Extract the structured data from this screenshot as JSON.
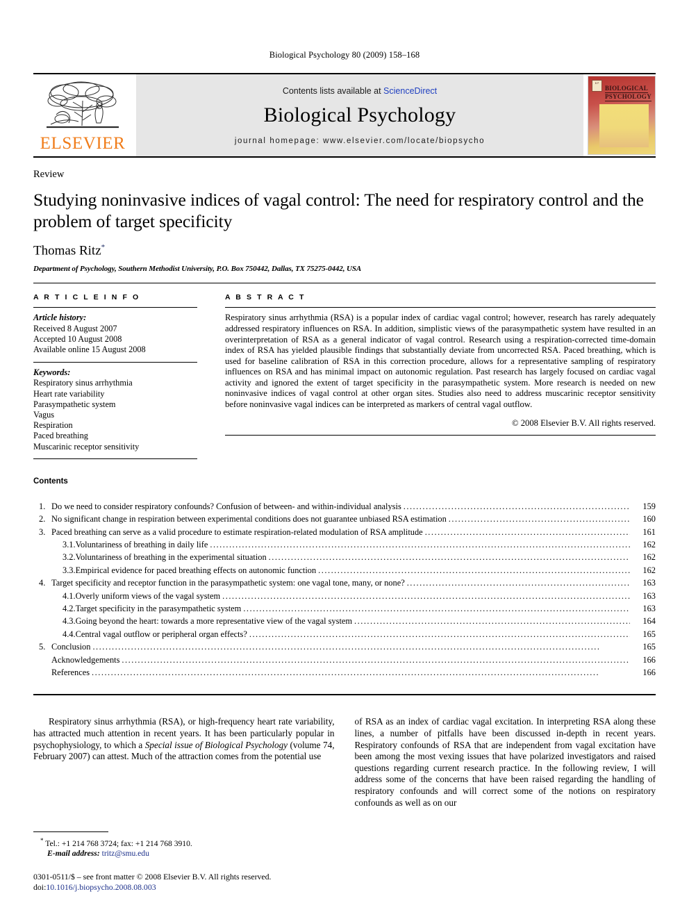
{
  "running_head": "Biological Psychology 80 (2009) 158–168",
  "masthead": {
    "publisher_name": "ELSEVIER",
    "contents_prefix": "Contents lists available at ",
    "contents_link": "ScienceDirect",
    "journal_name": "Biological Psychology",
    "homepage": "journal homepage: www.elsevier.com/locate/biopsycho",
    "cover": {
      "line1": "BIOLOGICAL",
      "line2": "PSYCHOLOGY",
      "mini_logo_text": "B P"
    }
  },
  "article": {
    "doctype": "Review",
    "title": "Studying noninvasive indices of vagal control: The need for respiratory control and the problem of target specificity",
    "author": "Thomas Ritz",
    "author_marker": "*",
    "affiliation": "Department of Psychology, Southern Methodist University, P.O. Box 750442, Dallas, TX 75275-0442, USA"
  },
  "info": {
    "heading": "A R T I C L E   I N F O",
    "history_label": "Article history:",
    "history": [
      "Received 8 August 2007",
      "Accepted 10 August 2008",
      "Available online 15 August 2008"
    ],
    "keywords_label": "Keywords:",
    "keywords": [
      "Respiratory sinus arrhythmia",
      "Heart rate variability",
      "Parasympathetic system",
      "Vagus",
      "Respiration",
      "Paced breathing",
      "Muscarinic receptor sensitivity"
    ]
  },
  "abstract": {
    "heading": "A B S T R A C T",
    "text": "Respiratory sinus arrhythmia (RSA) is a popular index of cardiac vagal control; however, research has rarely adequately addressed respiratory influences on RSA. In addition, simplistic views of the parasympathetic system have resulted in an overinterpretation of RSA as a general indicator of vagal control. Research using a respiration-corrected time-domain index of RSA has yielded plausible findings that substantially deviate from uncorrected RSA. Paced breathing, which is used for baseline calibration of RSA in this correction procedure, allows for a representative sampling of respiratory influences on RSA and has minimal impact on autonomic regulation. Past research has largely focused on cardiac vagal activity and ignored the extent of target specificity in the parasympathetic system. More research is needed on new noninvasive indices of vagal control at other organ sites. Studies also need to address muscarinic receptor sensitivity before noninvasive vagal indices can be interpreted as markers of central vagal outflow.",
    "copyright": "© 2008 Elsevier B.V. All rights reserved."
  },
  "contents": {
    "heading": "Contents",
    "entries": [
      {
        "num": "1.",
        "sub": false,
        "text": "Do we need to consider respiratory confounds? Confusion of between- and within-individual analysis",
        "page": "159"
      },
      {
        "num": "2.",
        "sub": false,
        "text": "No significant change in respiration between experimental conditions does not guarantee unbiased RSA estimation",
        "page": "160"
      },
      {
        "num": "3.",
        "sub": false,
        "text": "Paced breathing can serve as a valid procedure to estimate respiration-related modulation of RSA amplitude",
        "page": "161"
      },
      {
        "num": "3.1.",
        "sub": true,
        "text": "Voluntariness of breathing in daily life",
        "page": "162"
      },
      {
        "num": "3.2.",
        "sub": true,
        "text": "Voluntariness of breathing in the experimental situation",
        "page": "162"
      },
      {
        "num": "3.3.",
        "sub": true,
        "text": "Empirical evidence for paced breathing effects on autonomic function",
        "page": "162"
      },
      {
        "num": "4.",
        "sub": false,
        "text": "Target specificity and receptor function in the parasympathetic system: one vagal tone, many, or none?",
        "page": "163"
      },
      {
        "num": "4.1.",
        "sub": true,
        "text": "Overly uniform views of the vagal system",
        "page": "163"
      },
      {
        "num": "4.2.",
        "sub": true,
        "text": "Target specificity in the parasympathetic system",
        "page": "163"
      },
      {
        "num": "4.3.",
        "sub": true,
        "text": "Going beyond the heart: towards a more representative view of the vagal system",
        "page": "164"
      },
      {
        "num": "4.4.",
        "sub": true,
        "text": "Central vagal outflow or peripheral organ effects?",
        "page": "165"
      },
      {
        "num": "5.",
        "sub": false,
        "text": "Conclusion",
        "page": "165"
      },
      {
        "num": "",
        "sub": false,
        "text": "Acknowledgements",
        "page": "166"
      },
      {
        "num": "",
        "sub": false,
        "text": "References",
        "page": "166"
      }
    ]
  },
  "body": {
    "left_col_part1": "Respiratory sinus arrhythmia (RSA), or high-frequency heart rate variability, has attracted much attention in recent years. It has been particularly popular in psychophysiology, to which a ",
    "left_col_italic": "Special issue of Biological Psychology",
    "left_col_part2": " (volume 74, February 2007) can attest. Much of the attraction comes from the potential use",
    "right_col": "of RSA as an index of cardiac vagal excitation. In interpreting RSA along these lines, a number of pitfalls have been discussed in-depth in recent years. Respiratory confounds of RSA that are independent from vagal excitation have been among the most vexing issues that have polarized investigators and raised questions regarding current research practice. In the following review, I will address some of the concerns that have been raised regarding the handling of respiratory confounds and will correct some of the notions on respiratory confounds as well as on our"
  },
  "footnotes": {
    "marker": "*",
    "contact": "Tel.: +1 214 768 3724; fax: +1 214 768 3910.",
    "email_label": "E-mail address:",
    "email": "tritz@smu.edu",
    "issn_line": "0301-0511/$ – see front matter © 2008 Elsevier B.V. All rights reserved.",
    "doi_prefix": "doi:",
    "doi": "10.1016/j.biopsycho.2008.08.003"
  }
}
